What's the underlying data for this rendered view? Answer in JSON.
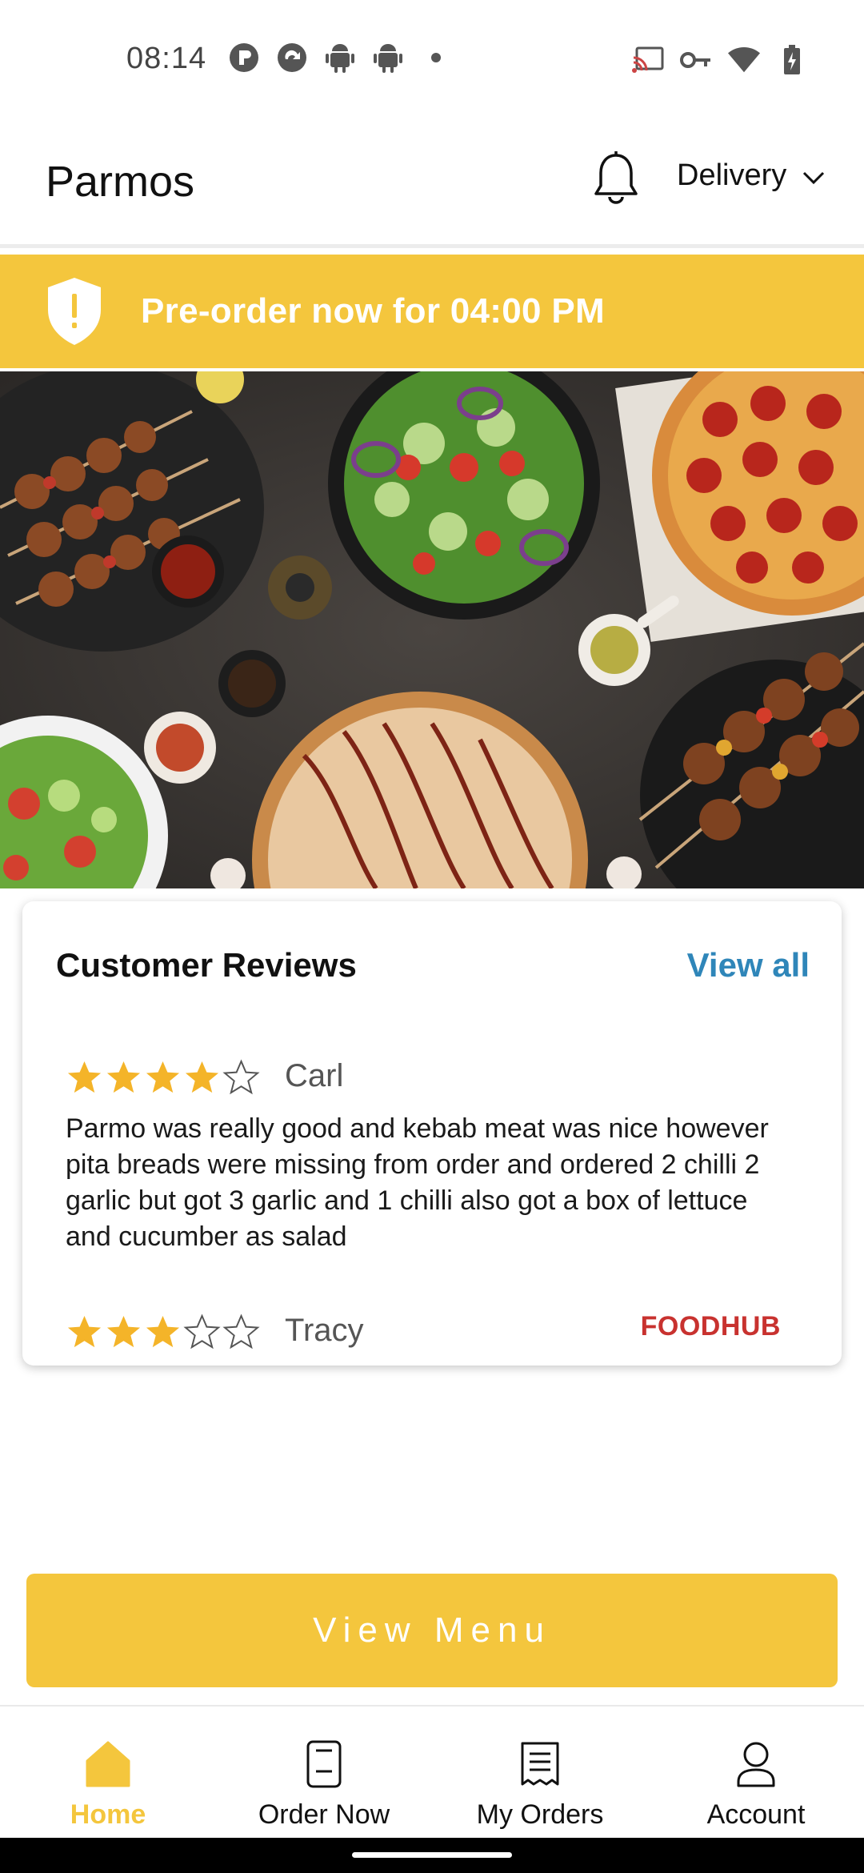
{
  "status_bar": {
    "time": "08:14",
    "left_icons": [
      "app-p-icon",
      "app-circle-icon",
      "android-icon",
      "android-icon",
      "dot-icon"
    ],
    "right_icons": [
      "cast-icon",
      "vpn-key-icon",
      "wifi-icon",
      "battery-icon"
    ]
  },
  "app_bar": {
    "title": "Parmos",
    "notification_icon": "bell-icon",
    "order_mode": "Delivery"
  },
  "banner": {
    "text": "Pre-order now for 04:00 PM",
    "icon": "shield-alert-icon"
  },
  "reviews": {
    "title": "Customer Reviews",
    "view_all": "View all",
    "items": [
      {
        "name": "Carl",
        "rating": 4,
        "max_rating": 5,
        "text": "Parmo was really good and kebab meat was nice however pita breads were missing from order and ordered 2 chilli 2 garlic but got 3 garlic and 1 chilli also got a box of lettuce and cucumber as salad"
      },
      {
        "name": "Tracy",
        "rating": 3,
        "max_rating": 5,
        "text": ""
      }
    ],
    "source_logo": "FOODHUB"
  },
  "cta": {
    "label": "View Menu"
  },
  "bottom_nav": {
    "items": [
      {
        "label": "Home",
        "icon": "home-icon",
        "active": true
      },
      {
        "label": "Order Now",
        "icon": "order-now-icon",
        "active": false
      },
      {
        "label": "My Orders",
        "icon": "receipt-icon",
        "active": false
      },
      {
        "label": "Account",
        "icon": "person-icon",
        "active": false
      }
    ]
  },
  "colors": {
    "accent": "#f4c63d",
    "link": "#2f86b9",
    "foodhub": "#c8322f"
  }
}
